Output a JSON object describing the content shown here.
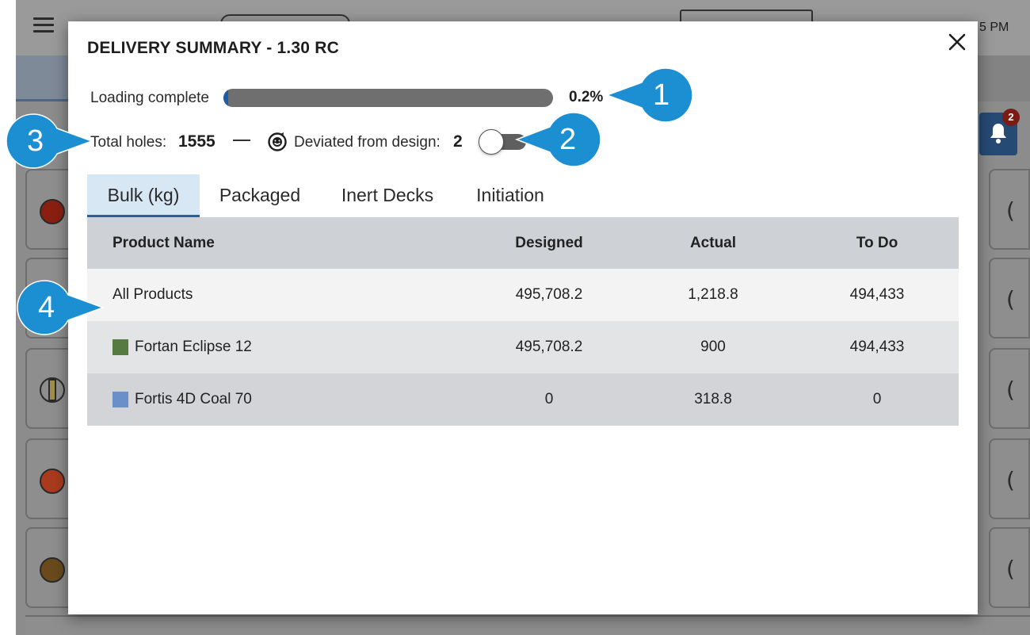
{
  "background": {
    "time_text": "5 PM",
    "notification_count": "2"
  },
  "modal": {
    "title": "DELIVERY SUMMARY - 1.30 RC",
    "loading": {
      "label": "Loading complete",
      "value_text": "0.2%",
      "progress_fraction": 0.002
    },
    "holes": {
      "total_label": "Total holes:",
      "total_value": "1555",
      "deviated_label": "Deviated from design:",
      "deviated_value": "2",
      "toggle_on": false
    },
    "tabs": [
      {
        "label": "Bulk (kg)",
        "active": true
      },
      {
        "label": "Packaged",
        "active": false
      },
      {
        "label": "Inert Decks",
        "active": false
      },
      {
        "label": "Initiation",
        "active": false
      }
    ],
    "table": {
      "columns": [
        "Product Name",
        "Designed",
        "Actual",
        "To Do"
      ],
      "rows": [
        {
          "name": "All Products",
          "swatch": "",
          "designed": "495,708.2",
          "actual": "1,218.8",
          "todo": "494,433"
        },
        {
          "name": "Fortan Eclipse 12",
          "swatch": "#577a42",
          "designed": "495,708.2",
          "actual": "900",
          "todo": "494,433"
        },
        {
          "name": "Fortis 4D Coal 70",
          "swatch": "#6a8fc9",
          "designed": "0",
          "actual": "318.8",
          "todo": "0"
        }
      ]
    }
  },
  "callouts": [
    "1",
    "2",
    "3",
    "4"
  ],
  "colors": {
    "callout": "#1b8fd2",
    "progress_track": "#6f6f6f",
    "tab_active_bg": "#d7e7f3",
    "table_header_bg": "#ced1d5"
  }
}
